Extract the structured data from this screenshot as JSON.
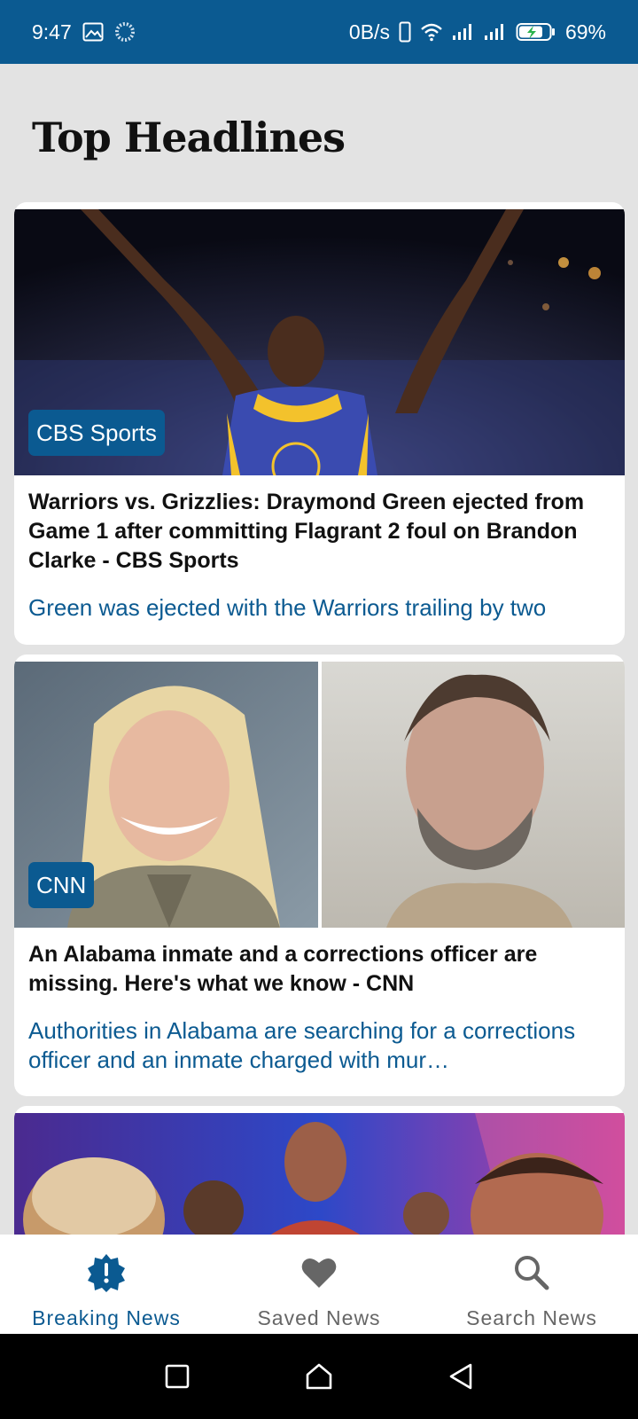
{
  "status_bar": {
    "time": "9:47",
    "network_speed": "0B/s",
    "battery": "69%",
    "icons": [
      "image-icon",
      "loading-icon",
      "phone-icon",
      "wifi-icon",
      "signal-icon",
      "signal-icon",
      "battery-charging-icon"
    ]
  },
  "page": {
    "title": "Top Headlines"
  },
  "articles": [
    {
      "source": "CBS Sports",
      "title": "Warriors vs. Grizzlies: Draymond Green ejected from Game 1 after committing Flagrant 2 foul on Brandon Clarke - CBS Sports",
      "description": "Green was ejected with the Warriors trailing by two"
    },
    {
      "source": "CNN",
      "title": "An Alabama inmate and a corrections officer are missing. Here's what we know - CNN",
      "description": "Authorities in Alabama are searching for a corrections officer and an inmate charged with mur…"
    },
    {
      "source": "",
      "title": "",
      "description": ""
    }
  ],
  "bottom_nav": {
    "items": [
      {
        "label": "Breaking News",
        "icon": "alert-badge-icon",
        "active": true
      },
      {
        "label": "Saved News",
        "icon": "heart-icon",
        "active": false
      },
      {
        "label": "Search News",
        "icon": "search-icon",
        "active": false
      }
    ]
  },
  "colors": {
    "primary": "#0b5a91",
    "background": "#e3e3e3",
    "inactive": "#666666"
  }
}
